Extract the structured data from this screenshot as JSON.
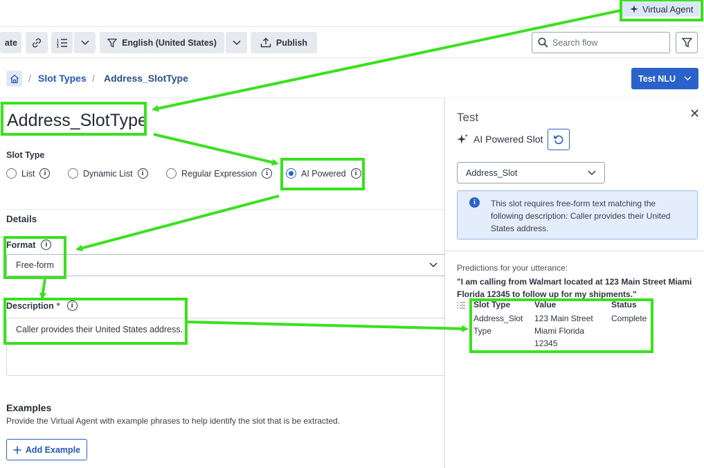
{
  "top": {
    "virtual_agent_label": "Virtual Agent"
  },
  "toolbar": {
    "partial_button_label": "ate",
    "language_label": "English (United States)",
    "publish_label": "Publish",
    "search_placeholder": "Search flow"
  },
  "breadcrumb": {
    "items": [
      "Slot Types",
      "Address_SlotType"
    ],
    "separator": "/"
  },
  "header": {
    "test_nlu_label": "Test NLU"
  },
  "main": {
    "title": "Address_SlotType",
    "slot_type_label": "Slot Type",
    "slot_types": [
      {
        "label": "List",
        "selected": false
      },
      {
        "label": "Dynamic List",
        "selected": false
      },
      {
        "label": "Regular Expression",
        "selected": false
      },
      {
        "label": "AI Powered",
        "selected": true
      }
    ],
    "details_label": "Details",
    "format_label": "Format",
    "format_value": "Free-form",
    "description_label": "Description",
    "required_marker": "*",
    "description_value": "Caller provides their United States address.",
    "examples_title": "Examples",
    "examples_desc": "Provide the Virtual Agent with example phrases to help identify the slot that is be extracted.",
    "add_example_label": "Add Example"
  },
  "test_panel": {
    "title": "Test",
    "subtitle": "AI Powered Slot",
    "slot_select_value": "Address_Slot",
    "info_text": "This slot requires free-form text matching the following description: Caller provides their United States address.",
    "predictions_label": "Predictions for your utterance:",
    "utterance": "\"I am calling from Walmart located at 123 Main Street Miami Florida 12345 to follow up for my shipments.\"",
    "table": {
      "headers": [
        "Slot Type",
        "Value",
        "Status"
      ],
      "rows": [
        {
          "slot_type": "Address_Slot Type",
          "value": "123 Main Street Miami Florida 12345",
          "status": "Complete"
        }
      ]
    }
  },
  "colors": {
    "accent": "#2a62c9",
    "highlight": "#39e11d",
    "link": "#2257b6"
  }
}
